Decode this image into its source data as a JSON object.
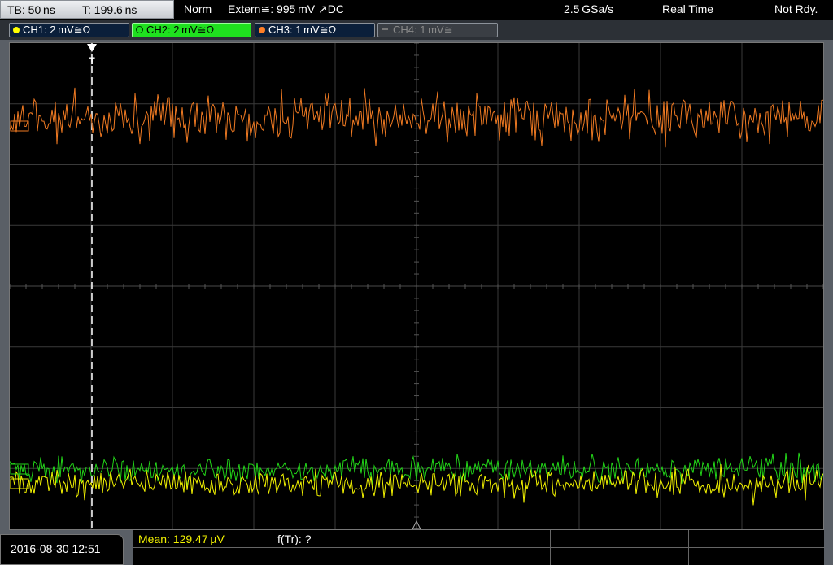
{
  "topbar": {
    "timebase": "TB: 50 ns",
    "trigger_time": "T: 199.6 ns",
    "mode": "Norm",
    "trigger_source": "Extern≅: 995 mV ↗DC",
    "sample_rate": "2.5 GSa/s",
    "acq_mode": "Real Time",
    "status": "Not Rdy."
  },
  "channels": [
    {
      "label": "CH1: 2 mV≅Ω",
      "color": "#ffff00",
      "active": false
    },
    {
      "label": "CH2: 2 mV≅Ω",
      "color": "#00cc00",
      "active": true
    },
    {
      "label": "CH3: 1 mV≅Ω",
      "color": "#ff7f27",
      "active": false
    },
    {
      "label": "CH4: 1 mV≅",
      "color": "#777777",
      "active": false
    }
  ],
  "colors": {
    "ch1": "#f2f200",
    "ch2": "#22d418",
    "ch3": "#f07a22",
    "grid": "#3a3a3a"
  },
  "icons": {
    "trigger_marker": "trigger-T-icon",
    "ground_markers": "channel-ground-icon"
  },
  "grid": {
    "h_divisions": 10,
    "v_divisions": 8
  },
  "measurement": {
    "mean": "Mean: 129.47 µV",
    "freq": "f(Tr): ?"
  },
  "datetime": "2016-08-30 12:51"
}
